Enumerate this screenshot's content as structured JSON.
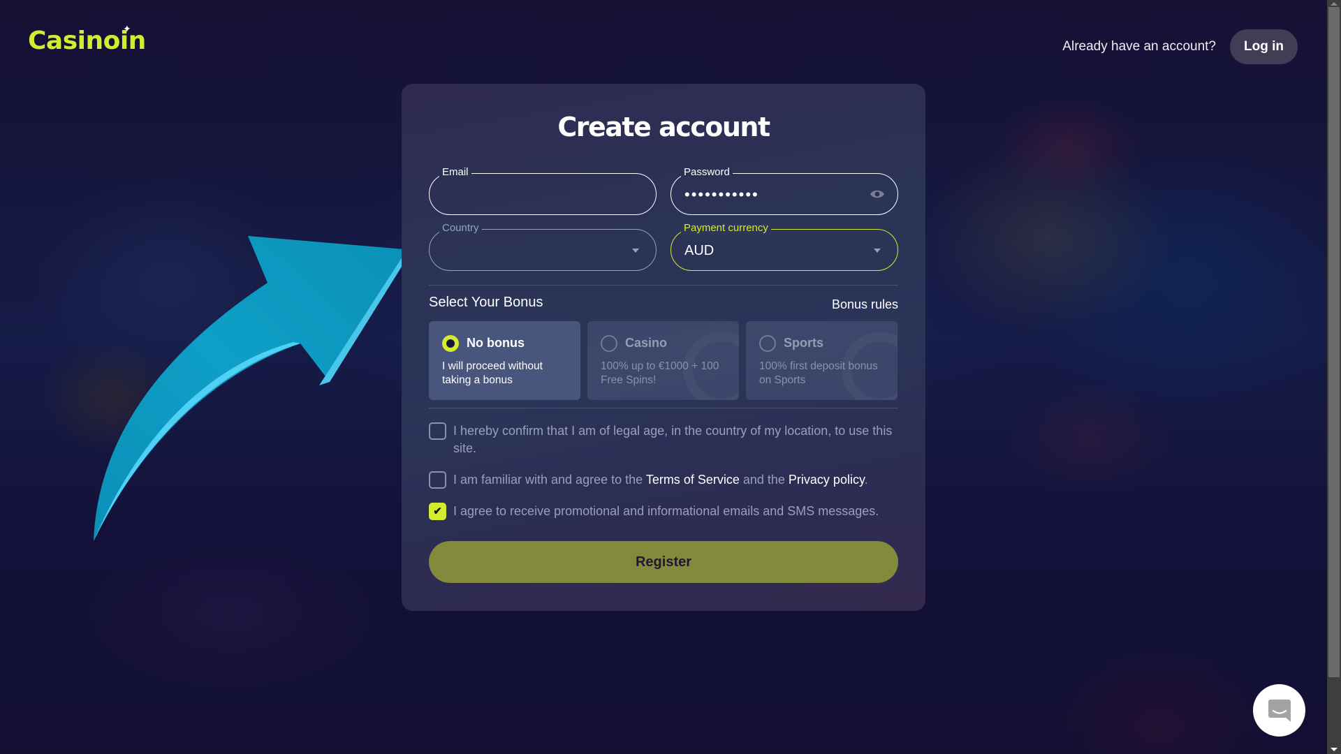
{
  "header": {
    "logo_text": "Casinoin",
    "logo_star": "✦",
    "have_account_text": "Already have an account?",
    "login_label": "Log in"
  },
  "form": {
    "title": "Create account",
    "email": {
      "label": "Email",
      "value": ""
    },
    "password": {
      "label": "Password",
      "value": "•••••••••••",
      "icon": "eye-icon"
    },
    "country": {
      "label": "Country",
      "value": "",
      "icon": "chevron-down-icon"
    },
    "currency": {
      "label": "Payment currency",
      "value": "AUD",
      "icon": "chevron-down-icon"
    },
    "bonus_section_title": "Select Your Bonus",
    "bonus_rules_label": "Bonus rules",
    "bonuses": [
      {
        "name": "No bonus",
        "description": "I will proceed without taking a bonus",
        "selected": true
      },
      {
        "name": "Casino",
        "description": "100% up to €1000 + 100 Free Spins!",
        "selected": false
      },
      {
        "name": "Sports",
        "description": "100% first deposit bonus on Sports",
        "selected": false
      }
    ],
    "checkboxes": [
      {
        "text": "I hereby confirm that I am of legal age, in the country of my location, to use this site.",
        "checked": false
      },
      {
        "text_before": "I am familiar with and agree to the ",
        "link1": "Terms of Service",
        "text_middle": " and the ",
        "link2": "Privacy policy",
        "text_after": ".",
        "checked": false
      },
      {
        "text": "I agree to receive promotional and informational emails and SMS messages.",
        "checked": true,
        "check_glyph": "✔"
      }
    ],
    "register_label": "Register"
  },
  "colors": {
    "accent": "#d4ec2f",
    "register_bg": "#848a3c",
    "arrow": "#0ea5c9"
  },
  "chat": {
    "icon": "chat-icon"
  }
}
